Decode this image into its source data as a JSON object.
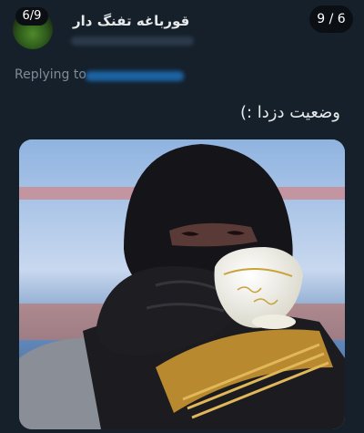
{
  "tweet": {
    "display_name": "قورباغه تفنگ دار",
    "avatar_badge": "6/9",
    "page_indicator": "9 / 6",
    "replying_to_label": "Replying to",
    "text": "وضعیت دزدا :)"
  },
  "colors": {
    "background": "#15202b",
    "link": "#1d9bf0",
    "muted": "#7f8b96"
  },
  "media": {
    "description_icon": "photo"
  }
}
